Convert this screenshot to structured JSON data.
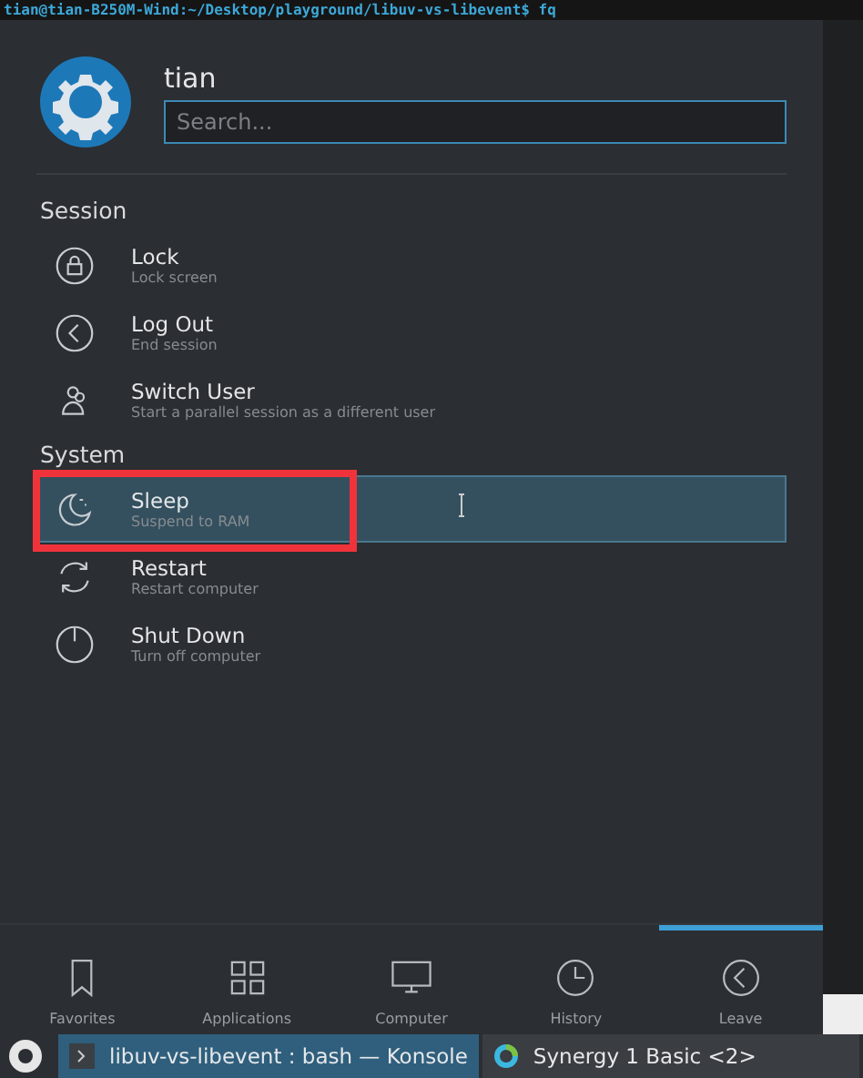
{
  "terminal_line": "tian@tian-B250M-Wind:~/Desktop/playground/libuv-vs-libevent$ fq",
  "user": {
    "name": "tian"
  },
  "search": {
    "placeholder": "Search..."
  },
  "sections": [
    {
      "title": "Session",
      "items": [
        {
          "kind": "lock",
          "label": "Lock",
          "description": "Lock screen",
          "selected": false,
          "highlighted": false
        },
        {
          "kind": "logout",
          "label": "Log Out",
          "description": "End session",
          "selected": false,
          "highlighted": false
        },
        {
          "kind": "switch",
          "label": "Switch User",
          "description": "Start a parallel session as a different user",
          "selected": false,
          "highlighted": false
        }
      ]
    },
    {
      "title": "System",
      "items": [
        {
          "kind": "sleep",
          "label": "Sleep",
          "description": "Suspend to RAM",
          "selected": true,
          "highlighted": true
        },
        {
          "kind": "restart",
          "label": "Restart",
          "description": "Restart computer",
          "selected": false,
          "highlighted": false
        },
        {
          "kind": "shutdown",
          "label": "Shut Down",
          "description": "Turn off computer",
          "selected": false,
          "highlighted": false
        }
      ]
    }
  ],
  "tabs": [
    {
      "kind": "favorites",
      "label": "Favorites",
      "selected": false
    },
    {
      "kind": "applications",
      "label": "Applications",
      "selected": false
    },
    {
      "kind": "computer",
      "label": "Computer",
      "selected": false
    },
    {
      "kind": "history",
      "label": "History",
      "selected": false
    },
    {
      "kind": "leave",
      "label": "Leave",
      "selected": true
    }
  ],
  "taskbar": [
    {
      "kind": "konsole",
      "label": "libuv-vs-libevent : bash — Konsole",
      "selected": true
    },
    {
      "kind": "synergy",
      "label": "Synergy 1 Basic <2>",
      "selected": false
    }
  ]
}
